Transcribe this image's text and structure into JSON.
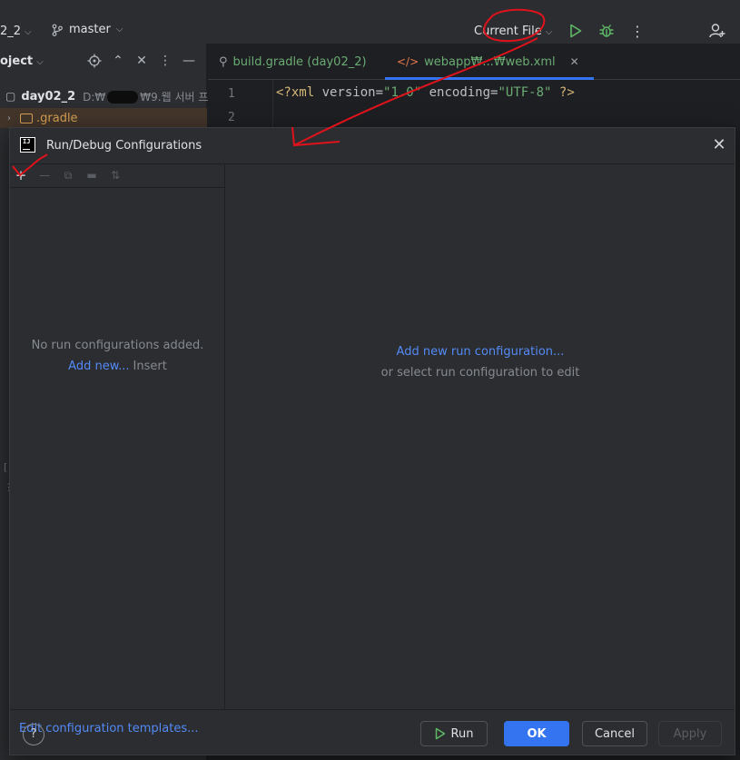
{
  "titlebar": {
    "project_name": "2_2",
    "branch": "master",
    "run_config": "Current File"
  },
  "project_panel": {
    "header": "oject",
    "root": {
      "name": "day02_2",
      "path": "D:₩",
      "path_tail": "₩9.웹 서버 프"
    },
    "selected": {
      "name": ".gradle"
    },
    "fragments": [
      "[",
      "⋮"
    ]
  },
  "editor": {
    "tabs": [
      {
        "label": "build.gradle (day02_2)"
      },
      {
        "label": "webapp₩...₩web.xml"
      }
    ],
    "line_numbers": [
      "1",
      "2"
    ],
    "code_line1": {
      "open": "<?xml ",
      "attr1": "version=",
      "val1": "\"1.0\"",
      "attr2": " encoding=",
      "val2": "\"UTF-8\"",
      "close": " ?>"
    }
  },
  "dialog": {
    "title": "Run/Debug Configurations",
    "logo_text": "IJ",
    "empty_message": "No run configurations added.",
    "add_new_link": "Add new...",
    "add_new_shortcut": "Insert",
    "templates_link": "Edit configuration templates...",
    "add_run_config_link": "Add new run configuration...",
    "select_hint": "or select run configuration to edit",
    "buttons": {
      "run": "Run",
      "ok": "OK",
      "cancel": "Cancel",
      "apply": "Apply"
    },
    "help": "?"
  },
  "colors": {
    "accent": "#3574f0",
    "link": "#548af7",
    "run_green": "#5fb865",
    "annotation_red": "#e0121b"
  }
}
